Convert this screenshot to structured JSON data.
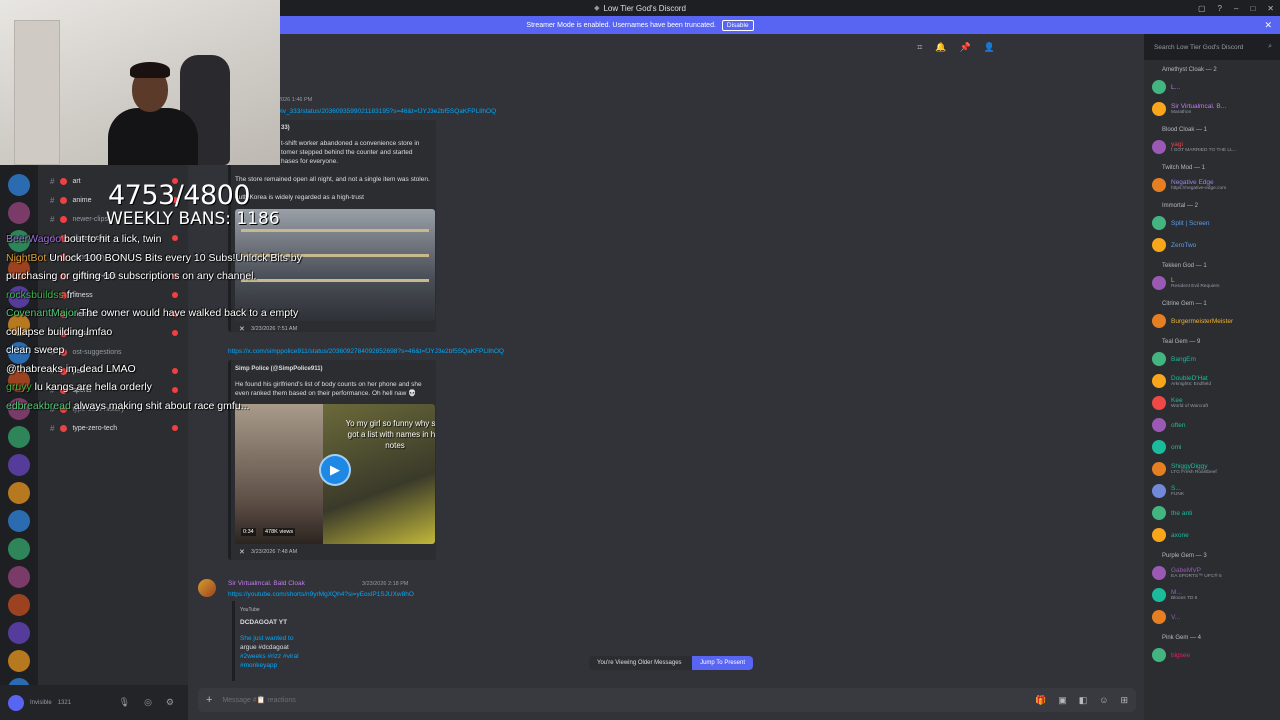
{
  "window": {
    "title": "Low Tier God's Discord"
  },
  "banner": {
    "text": "Streamer Mode is enabled. Usernames have been truncated.",
    "disable_label": "Disable"
  },
  "search": {
    "placeholder": "Search Low Tier God's Discord"
  },
  "stream_overlay": {
    "counter": "4753/4800",
    "weekly_bans": "WEEKLY BANS: 1186",
    "chat": [
      {
        "user": "BeerWagoo",
        "text": "bout to hit a lick, twin"
      },
      {
        "user": "NightBot",
        "text": "Unlock 100 BONUS Bits every 10 Subs!Unlock Bits by"
      },
      {
        "user": "",
        "text": "purchasing or gifting 10 subscriptions on any channel."
      },
      {
        "user": "rocksbuildss",
        "text": "fr"
      },
      {
        "user": "CovenantMajor",
        "text": "The owner would have walked back to a empty"
      },
      {
        "user": "",
        "text": "collapse building lmfao"
      },
      {
        "user": "",
        "text": "clean sweep"
      },
      {
        "user": "",
        "text": "@thabreaks im dead LMAO"
      },
      {
        "user": "gruyy",
        "text": "lu kangs are hella orderly"
      },
      {
        "user": "edbreakbread",
        "text": "always making shit about race gmfu..."
      }
    ]
  },
  "channels": [
    {
      "name": "art",
      "unread": true
    },
    {
      "name": "anime",
      "unread": true
    },
    {
      "name": "newer-clips",
      "unread": false
    },
    {
      "name": "classic-clips",
      "unread": true
    },
    {
      "name": "conspiracy",
      "unread": false
    },
    {
      "name": "covenant-eats",
      "unread": true
    },
    {
      "name": "fitness",
      "unread": true
    },
    {
      "name": "memes",
      "unread": true
    },
    {
      "name": "music",
      "unread": true
    },
    {
      "name": "ost-suggestions",
      "unread": false
    },
    {
      "name": "pets",
      "unread": true
    },
    {
      "name": "sports",
      "unread": true
    },
    {
      "name": "type-zero-history",
      "unread": false
    },
    {
      "name": "type-zero-tech",
      "unread": true
    }
  ],
  "user_panel": {
    "status": "Invisible",
    "count": "1321"
  },
  "messages": {
    "m1_time": "2026 1:46 PM",
    "m1_link": "viv_333/status/2036093599021183195?s=46&t=fJYJ3e2bf5SQaKFPLIlhOQ",
    "m1_lines": [
      "t-shift worker abandoned a convenience store in",
      "tomer stepped behind the counter and started",
      "hases for everyone."
    ],
    "m1_line2": "The store remained open all night, and not a single item was stolen.",
    "m1_line3": "outh Korea is widely regarded as a high-trust",
    "m1_foot": "3/23/2026 7:51 AM",
    "m2_link": "https://x.com/simppolice911/status/2036092784092852698?s=46&t=fJYJ3e2bf5SQaKFPLIlhOQ",
    "m2_author": "Simp Police (@SimpPolice911)",
    "m2_text": [
      "He found his girlfriend's list of body counts on her phone and she",
      "even ranked them based on their performance. Oh hell naw 💀"
    ],
    "m2_caption": "Yo my girl so funny why she got a list with names in her notes",
    "m2_duration": "0:34",
    "m2_views": "478K views",
    "m2_foot": "3/23/2026 7:48 AM",
    "m3_author": "Sir Virtualmcal. Bald Cloak",
    "m3_tag": "Bald",
    "m3_time": "3/23/2026 2:18 PM",
    "m3_link": "https://youtube.com/shorts/n9yrMgXQh4?si=yEoxlP1SJUXw8hO",
    "m3_source": "YouTube",
    "m3_channel": "DCDAGOAT YT",
    "m3_desc": [
      "She just wanted to",
      "argue #dcdagoat",
      "#2weeks #rizz #viral",
      "#monkeyapp"
    ]
  },
  "older_bar": {
    "label": "You're Viewing Older Messages",
    "jump_label": "Jump To Present"
  },
  "composer": {
    "placeholder": "Message #📋 reactions"
  },
  "members": [
    {
      "role": "Amethyst Cloak — 2"
    },
    {
      "name": "L...",
      "status": "",
      "color": "#c27cf0"
    },
    {
      "name": "Sir Virtualmcal. B...",
      "status": "Marathon",
      "color": "#c27cf0"
    },
    {
      "role": "Blood Cloak — 1"
    },
    {
      "name": "yagi",
      "status": "I GOT MARRIED TO THE LL...",
      "color": "#ed4245"
    },
    {
      "role": "Twitch Mod — 1"
    },
    {
      "name": "Negative Edge",
      "status": "https://negative-edge.com",
      "color": "#9b84ec"
    },
    {
      "role": "Immortal — 2"
    },
    {
      "name": "Split | Screen",
      "status": "",
      "color": "#5c9ded"
    },
    {
      "name": "ZeroTwo",
      "status": "",
      "color": "#5c9ded"
    },
    {
      "role": "Tekken God — 1"
    },
    {
      "name": "L",
      "status": "Resident Evil Requiem",
      "color": "#e7a33e"
    },
    {
      "role": "Citrine Gem — 1"
    },
    {
      "name": "BurgermeisterMeister",
      "status": "",
      "color": "#f0b232"
    },
    {
      "role": "Teal Gem — 9"
    },
    {
      "name": "BangEm",
      "status": "",
      "color": "#1abc9c"
    },
    {
      "name": "DoubleD'Hat",
      "status": "Arknights: Endfield",
      "color": "#1abc9c"
    },
    {
      "name": "Kee",
      "status": "World of Warcraft",
      "color": "#1abc9c"
    },
    {
      "name": "often",
      "status": "",
      "color": "#1abc9c"
    },
    {
      "name": "omi",
      "status": "",
      "color": "#1abc9c"
    },
    {
      "name": "ShiggyDiggy",
      "status": "LTG Fresh Roastbeef",
      "color": "#1abc9c"
    },
    {
      "name": "S...",
      "status": "FUNK",
      "color": "#1abc9c"
    },
    {
      "name": "the anti",
      "status": "",
      "color": "#1abc9c"
    },
    {
      "name": "axone",
      "status": "",
      "color": "#1abc9c"
    },
    {
      "role": "Purple Gem — 3"
    },
    {
      "name": "GabeMVP",
      "status": "EA SPORTS™ UFC® 5",
      "color": "#9b59b6"
    },
    {
      "name": "M...",
      "status": "Bloons TD 6",
      "color": "#9b59b6"
    },
    {
      "name": "V...",
      "status": "",
      "color": "#9b59b6"
    },
    {
      "role": "Pink Gem — 4"
    },
    {
      "name": "bigsee",
      "status": "",
      "color": "#e91e63"
    }
  ]
}
